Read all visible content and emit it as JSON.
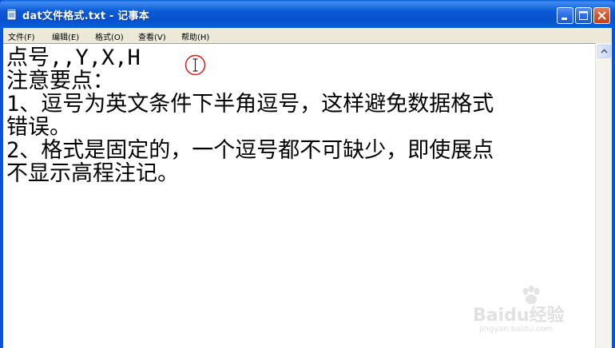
{
  "window": {
    "title": "dat文件格式.txt - 记事本",
    "frame_color": "#0a53d6",
    "close_color": "#d1552d"
  },
  "menu": {
    "items": [
      {
        "label": "文件(F)"
      },
      {
        "label": "编辑(E)"
      },
      {
        "label": "格式(O)"
      },
      {
        "label": "查看(V)"
      },
      {
        "label": "帮助(H)"
      }
    ]
  },
  "editor": {
    "lines": [
      "点号,,Y,X,H",
      "注意要点：",
      "1、逗号为英文条件下半角逗号，这样避免数据格式",
      "错误。",
      "2、格式是固定的，一个逗号都不可缺少，即使展点",
      "不显示高程注记。"
    ]
  },
  "watermark": {
    "brand": "Baidu经验",
    "url": "jingyan.baidu.com"
  }
}
